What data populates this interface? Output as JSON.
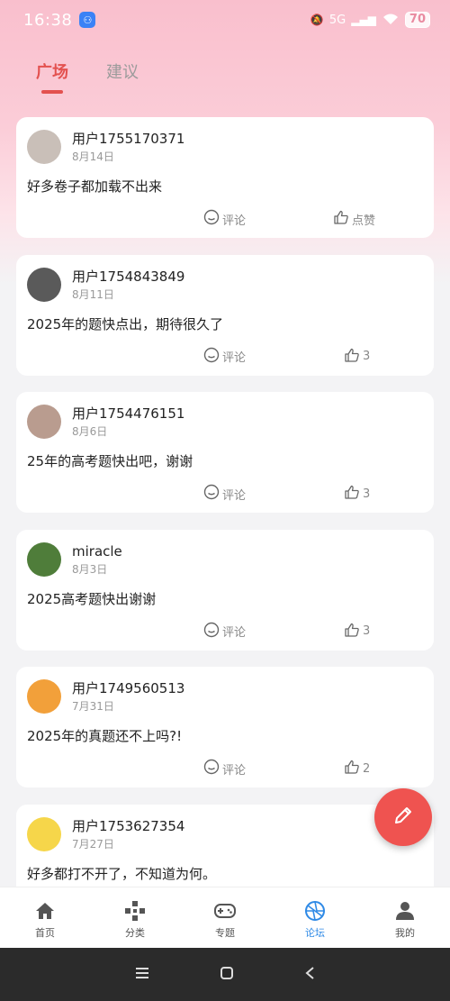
{
  "status_bar": {
    "time": "16:38",
    "network": "5G",
    "battery": "70"
  },
  "tabs": [
    {
      "label": "广场",
      "active": true
    },
    {
      "label": "建议",
      "active": false
    }
  ],
  "posts": [
    {
      "username": "用户1755170371",
      "date": "8月14日",
      "content": "好多卷子都加载不出来",
      "comment_label": "评论",
      "like_label": "点赞",
      "avatar_color": "#c9bfb8"
    },
    {
      "username": "用户1754843849",
      "date": "8月11日",
      "content": "2025年的题快点出，期待很久了",
      "comment_label": "评论",
      "like_label": "3",
      "avatar_color": "#5a5a5a"
    },
    {
      "username": "用户1754476151",
      "date": "8月6日",
      "content": "25年的高考题快出吧，谢谢",
      "comment_label": "评论",
      "like_label": "3",
      "avatar_color": "#b99c8f"
    },
    {
      "username": "miracle",
      "date": "8月3日",
      "content": "2025高考题快出谢谢",
      "comment_label": "评论",
      "like_label": "3",
      "avatar_color": "#4f7d3a"
    },
    {
      "username": "用户1749560513",
      "date": "7月31日",
      "content": "2025年的真题还不上吗?!",
      "comment_label": "评论",
      "like_label": "2",
      "avatar_color": "#f2a03a"
    },
    {
      "username": "用户1753627354",
      "date": "7月27日",
      "content": "好多都打不开了，不知道为何。",
      "comment_label": "评论",
      "like_label": "",
      "avatar_color": "#f6d64a"
    }
  ],
  "bottom_nav": [
    {
      "label": "首页",
      "icon": "home-icon",
      "active": false
    },
    {
      "label": "分类",
      "icon": "category-icon",
      "active": false
    },
    {
      "label": "专题",
      "icon": "gamepad-icon",
      "active": false
    },
    {
      "label": "论坛",
      "icon": "forum-icon",
      "active": true
    },
    {
      "label": "我的",
      "icon": "profile-icon",
      "active": false
    }
  ],
  "colors": {
    "accent": "#e3514f",
    "nav_active": "#2f8ae6",
    "fab": "#ef5350"
  }
}
